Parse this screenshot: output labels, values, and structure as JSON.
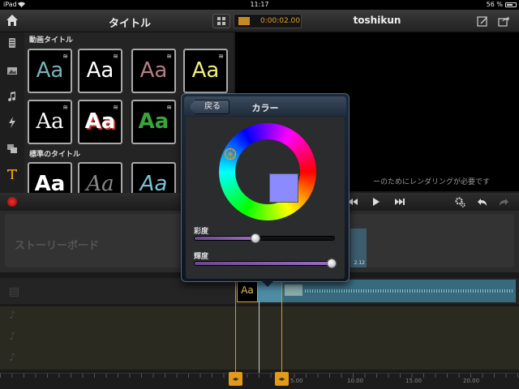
{
  "status_bar": {
    "device": "iPad",
    "time": "11:17",
    "battery": "56 %",
    "battery_level": 0.56
  },
  "toolbar": {
    "panel_title": "タイトル",
    "timecode": "0:00:02.00",
    "project_name": "toshikun"
  },
  "titles": {
    "section_animated": "動画タイトル",
    "section_standard": "標準のタイトル",
    "tile_text": "Aa",
    "tiles": [
      {
        "color": "#79b2b6",
        "animated": true
      },
      {
        "color": "#ffffff",
        "animated": true
      },
      {
        "color": "#b47f84",
        "animated": true
      },
      {
        "color": "#f2ef7a",
        "animated": true
      },
      {
        "color": "#ffffff",
        "animated": true
      },
      {
        "color": "#ffffff",
        "animated": true
      },
      {
        "color": "#3aa33a",
        "animated": true
      },
      {
        "color": "#ffffff",
        "animated": false
      },
      {
        "color": "#888888",
        "animated": false
      },
      {
        "color": "#79c4d8",
        "animated": false
      }
    ]
  },
  "preview": {
    "render_message": "ーのためにレンダリングが必要です"
  },
  "storyboard": {
    "label": "ストーリーボード",
    "clip_time": "2.12"
  },
  "timeline": {
    "title_clip_text": "Aa",
    "ticks": [
      "5.00",
      "10.00",
      "15.00",
      "20.00"
    ]
  },
  "color_popover": {
    "back_label": "戻る",
    "title": "カラー",
    "selected_color": "#8b8bff",
    "saturation_label": "彩度",
    "saturation_value": 0.43,
    "brightness_label": "輝度",
    "brightness_value": 0.97
  },
  "colors": {
    "accent": "#e39a18",
    "record": "#dd3333"
  }
}
